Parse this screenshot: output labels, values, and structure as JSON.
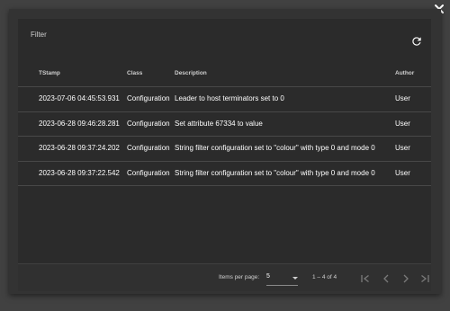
{
  "dialog": {
    "close_icon": "close-icon"
  },
  "filter": {
    "placeholder": "Filter",
    "refresh_icon": "refresh-icon"
  },
  "table": {
    "headers": [
      "TStamp",
      "Class",
      "Description",
      "Author"
    ],
    "rows": [
      [
        "2023-07-06 04:45:53.931",
        "Configuration",
        "Leader to host terminators set to 0",
        "User"
      ],
      [
        "2023-06-28 09:46:28.281",
        "Configuration",
        "Set attribute 67334 to value",
        "User"
      ],
      [
        "2023-06-28 09:37:24.202",
        "Configuration",
        "String filter configuration set to \"colour\" with type 0 and mode 0",
        "User"
      ],
      [
        "2023-06-28 09:37:22.542",
        "Configuration",
        "String filter configuration set to \"colour\" with type 0 and mode 0",
        "User"
      ]
    ]
  },
  "paginator": {
    "items_per_page_label": "Items per page:",
    "page_size": "5",
    "range_label": "1 – 4 of 4",
    "icons": [
      "first-page-icon",
      "previous-page-icon",
      "next-page-icon",
      "last-page-icon"
    ]
  },
  "colors": {
    "backdrop": "#414141",
    "dialog": "#333333",
    "panel": "#2b2b2b",
    "text": "#ffffff"
  }
}
